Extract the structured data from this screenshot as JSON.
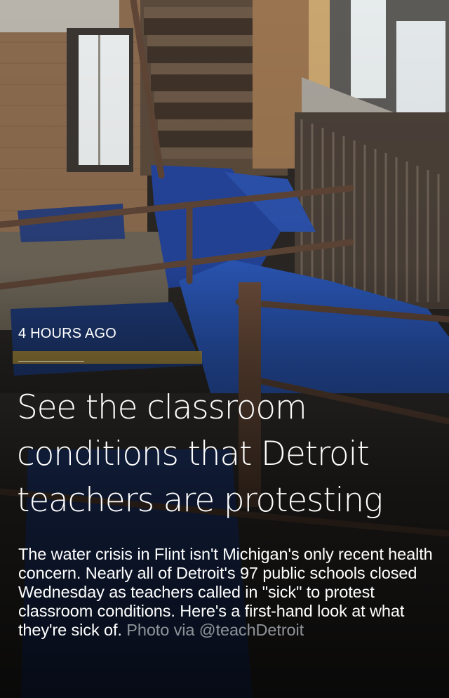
{
  "story": {
    "timestamp": "4 HOURS AGO",
    "headline": "See the classroom conditions that Detroit teachers are protesting",
    "summary": "The water crisis in Flint isn't Michigan's only recent health concern. Nearly all of Detroit's 97 public schools closed Wednesday as teachers called in \"sick\" to protest classroom conditions. Here's a first-hand look at what they're sick of.",
    "photo_credit": "Photo via @teachDetroit"
  }
}
